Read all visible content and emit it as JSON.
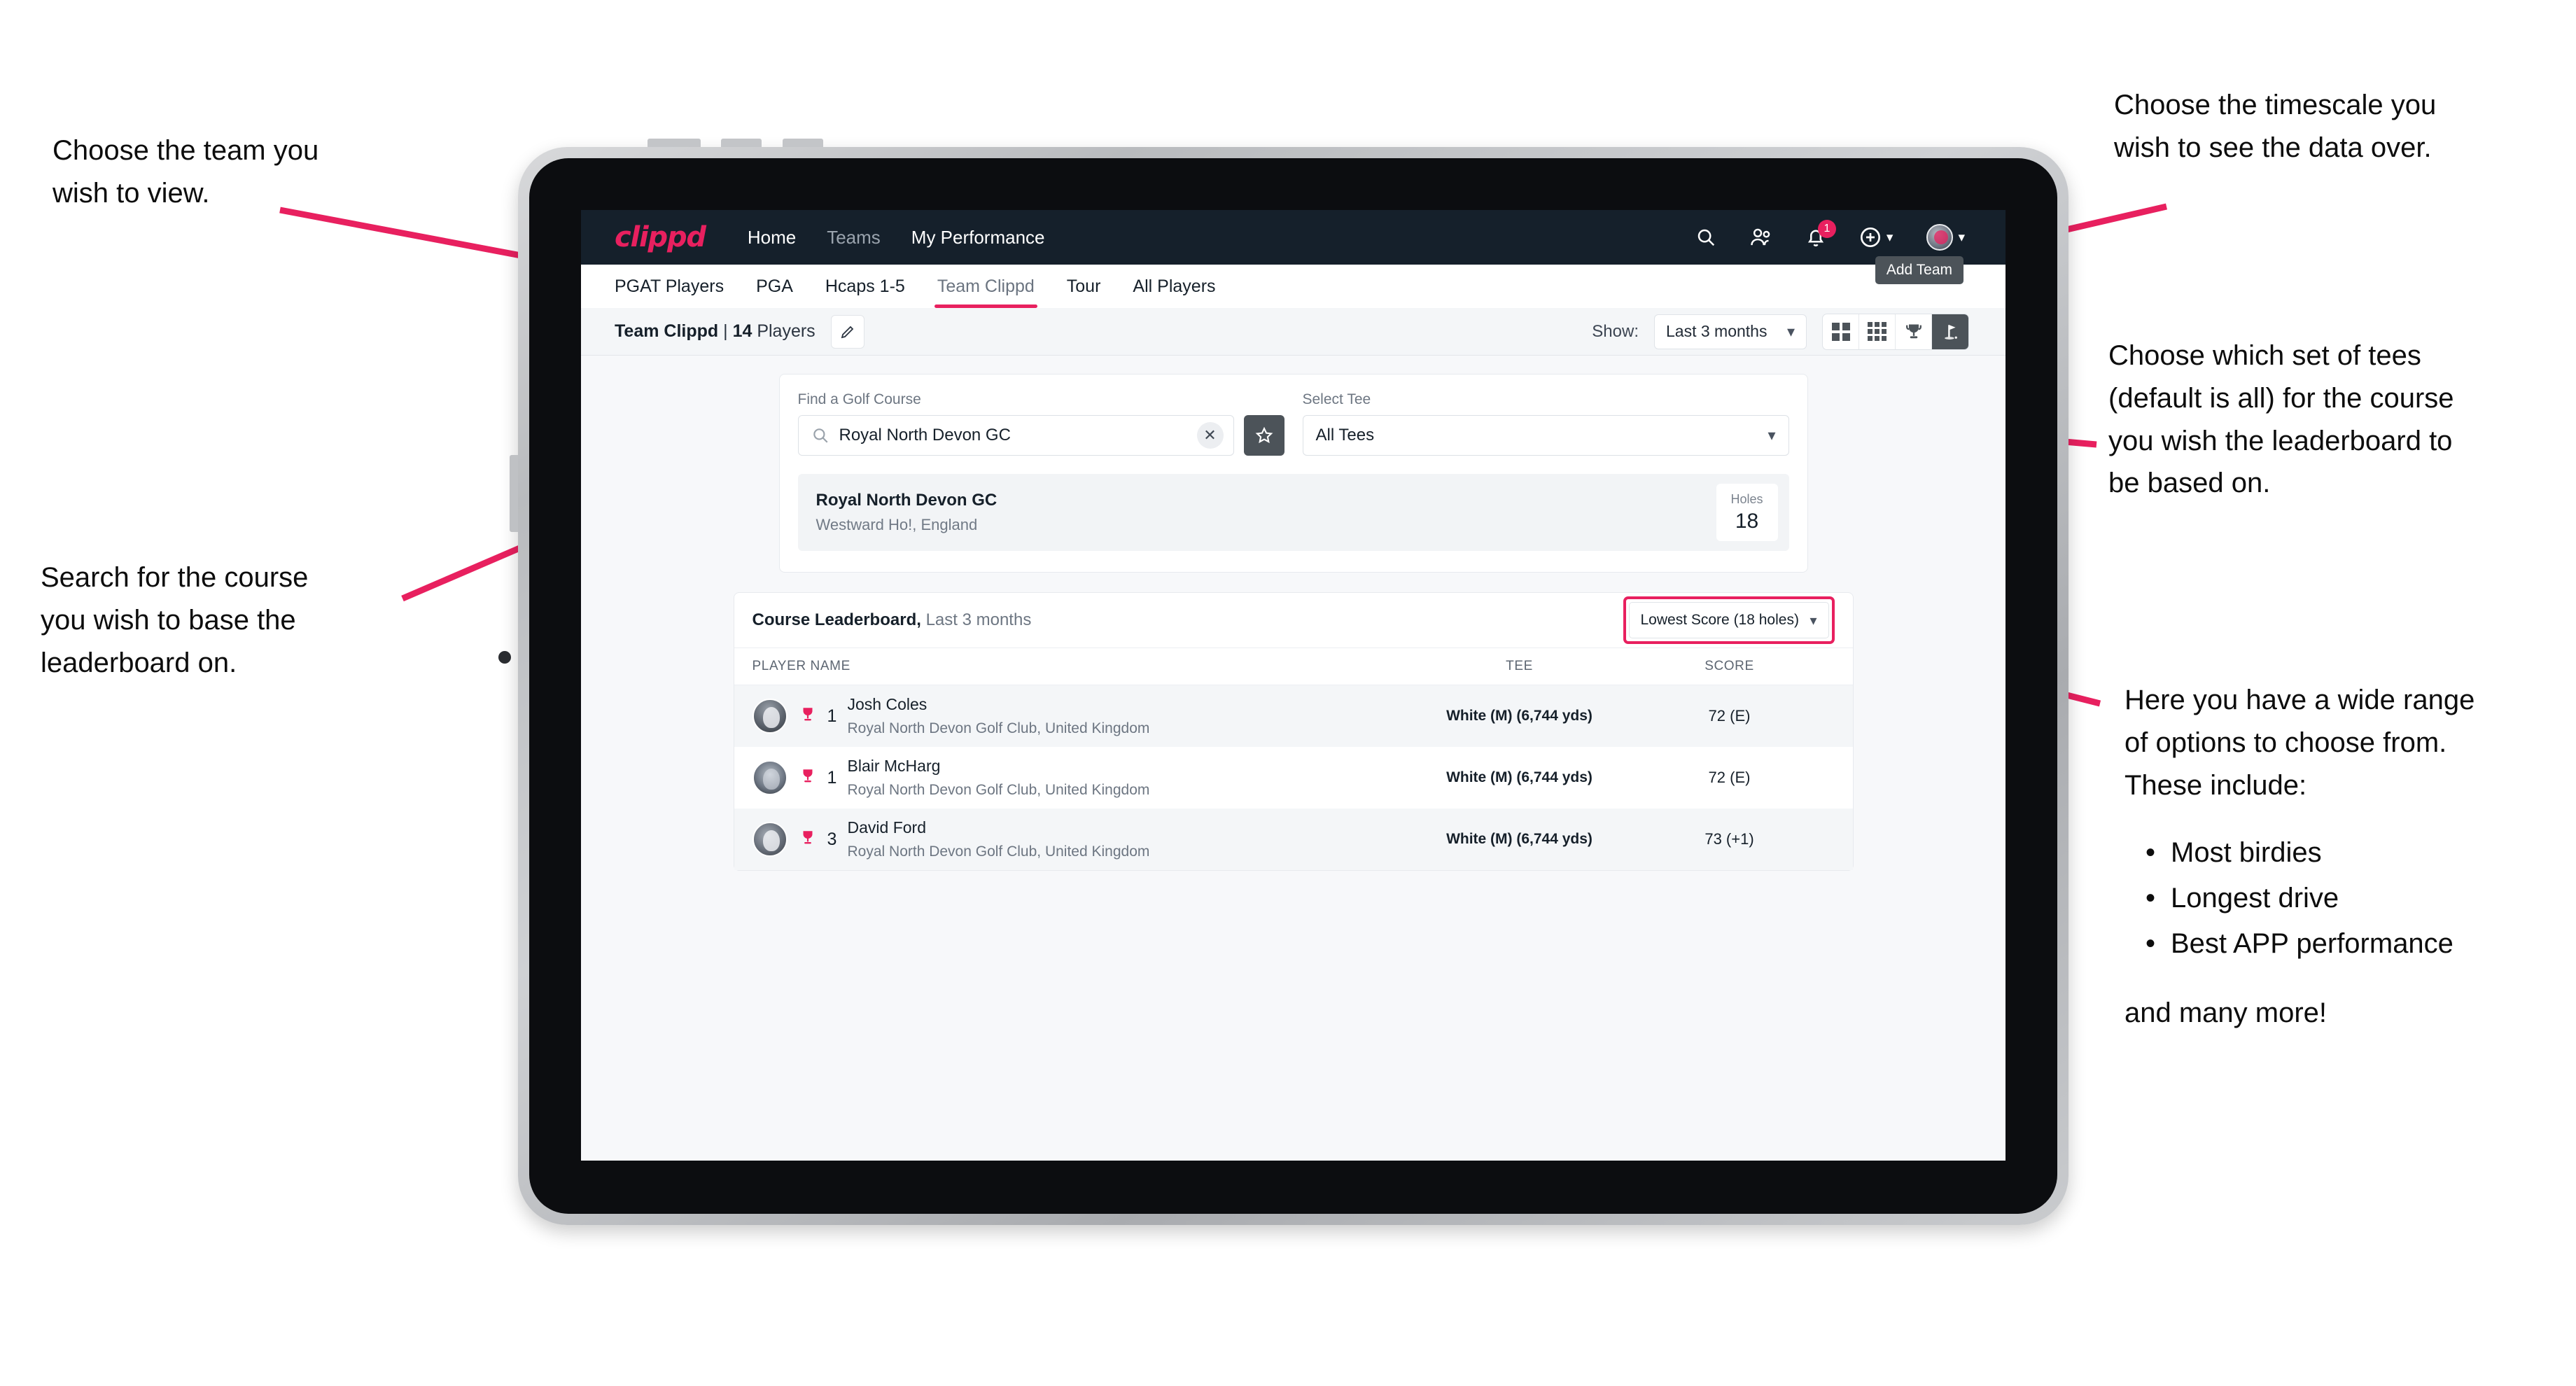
{
  "annotations": {
    "team": "Choose the team you\nwish to view.",
    "search": "Search for the course\nyou wish to base the\nleaderboard on.",
    "timescale": "Choose the timescale you\nwish to see the data over.",
    "tees": "Choose which set of tees\n(default is all) for the course\nyou wish the leaderboard to\nbe based on.",
    "options_intro": "Here you have a wide range\nof options to choose from.\nThese include:",
    "options_list": [
      "Most birdies",
      "Longest drive",
      "Best APP performance"
    ],
    "options_outro": "and many more!"
  },
  "app": {
    "logo": "clippd",
    "nav": [
      {
        "label": "Home",
        "dim": false
      },
      {
        "label": "Teams",
        "dim": true
      },
      {
        "label": "My Performance",
        "dim": false
      }
    ],
    "header_icons": [
      {
        "name": "search-icon"
      },
      {
        "name": "people-icon"
      },
      {
        "name": "bell-icon",
        "badge": "1"
      },
      {
        "name": "plus-circle-icon"
      },
      {
        "name": "avatar"
      }
    ],
    "tooltip": "Add Team",
    "tabs": [
      {
        "label": "PGAT Players",
        "active": false
      },
      {
        "label": "PGA",
        "active": false
      },
      {
        "label": "Hcaps 1-5",
        "active": false
      },
      {
        "label": "Team Clippd",
        "active": true
      },
      {
        "label": "Tour",
        "active": false
      },
      {
        "label": "All Players",
        "active": false
      }
    ],
    "subheader": {
      "team_name": "Team Clippd",
      "separator": " | ",
      "player_count": "14",
      "players_word": " Players",
      "show_label": "Show:",
      "show_value": "Last 3 months",
      "view_toggles": [
        {
          "name": "grid-2x2-icon",
          "active": false
        },
        {
          "name": "grid-3x3-icon",
          "active": false
        },
        {
          "name": "trophy-icon",
          "active": false
        },
        {
          "name": "golf-flag-icon",
          "active": true
        }
      ]
    },
    "search_card": {
      "course_label": "Find a Golf Course",
      "course_value": "Royal North Devon GC",
      "course_placeholder": "Find a Golf Course",
      "tee_label": "Select Tee",
      "tee_value": "All Tees",
      "result": {
        "name": "Royal North Devon GC",
        "location": "Westward Ho!, England",
        "holes_label": "Holes",
        "holes_value": "18"
      }
    },
    "leaderboard": {
      "title": "Course Leaderboard,",
      "subtitle": " Last 3 months",
      "sort_value": "Lowest Score (18 holes)",
      "columns": [
        "PLAYER NAME",
        "TEE",
        "SCORE"
      ],
      "rows": [
        {
          "rank": "1",
          "name": "Josh Coles",
          "club": "Royal North Devon Golf Club, United Kingdom",
          "tee": "White (M) (6,744 yds)",
          "score": "72 (E)"
        },
        {
          "rank": "1",
          "name": "Blair McHarg",
          "club": "Royal North Devon Golf Club, United Kingdom",
          "tee": "White (M) (6,744 yds)",
          "score": "72 (E)"
        },
        {
          "rank": "3",
          "name": "David Ford",
          "club": "Royal North Devon Golf Club, United Kingdom",
          "tee": "White (M) (6,744 yds)",
          "score": "73 (+1)"
        }
      ]
    }
  },
  "colors": {
    "brand_pink": "#e8205f",
    "header_dark": "#15202b",
    "toggle_dark": "#4c5359",
    "page_bg": "#f7f8fa"
  }
}
